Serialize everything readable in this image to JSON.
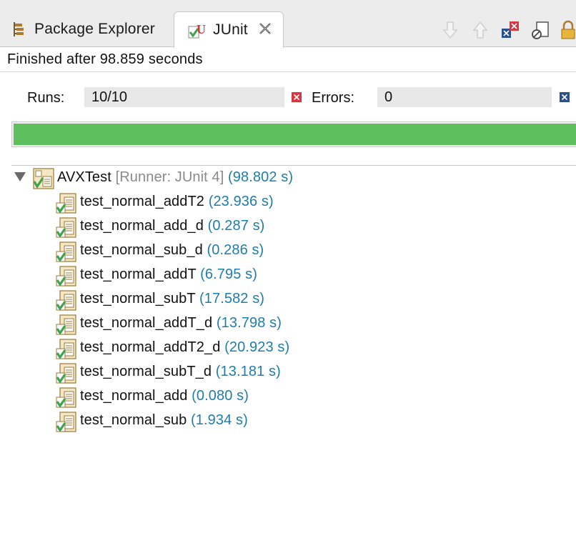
{
  "tabs": {
    "package_explorer": "Package Explorer",
    "junit": "JUnit"
  },
  "toolbar": {
    "icons": [
      "next-failure-icon",
      "previous-failure-icon",
      "show-failures-only-icon",
      "scroll-lock-icon",
      "history-icon"
    ]
  },
  "status": {
    "text": "Finished after 98.859 seconds"
  },
  "counters": {
    "runs_label": "Runs:",
    "runs_value": "10/10",
    "errors_label": "Errors:",
    "errors_value": "0"
  },
  "progress": {
    "fraction": 1.0,
    "color": "#5dbf5d"
  },
  "tree": {
    "root": {
      "name": "AVXTest",
      "runner": "[Runner: JUnit 4]",
      "time": "(98.802 s)"
    },
    "tests": [
      {
        "name": "test_normal_addT2",
        "time": "(23.936 s)"
      },
      {
        "name": "test_normal_add_d",
        "time": "(0.287 s)"
      },
      {
        "name": "test_normal_sub_d",
        "time": "(0.286 s)"
      },
      {
        "name": "test_normal_addT",
        "time": "(6.795 s)"
      },
      {
        "name": "test_normal_subT",
        "time": "(17.582 s)"
      },
      {
        "name": "test_normal_addT_d",
        "time": "(13.798 s)"
      },
      {
        "name": "test_normal_addT2_d",
        "time": "(20.923 s)"
      },
      {
        "name": "test_normal_subT_d",
        "time": "(13.181 s)"
      },
      {
        "name": "test_normal_add",
        "time": "(0.080 s)"
      },
      {
        "name": "test_normal_sub",
        "time": "(1.934 s)"
      }
    ]
  },
  "colors": {
    "time_text": "#1f7dab",
    "runner_text": "#8a8a8a",
    "success_green": "#3fa34d",
    "error_red": "#d9363e",
    "failure_blue": "#2c4f8a"
  }
}
